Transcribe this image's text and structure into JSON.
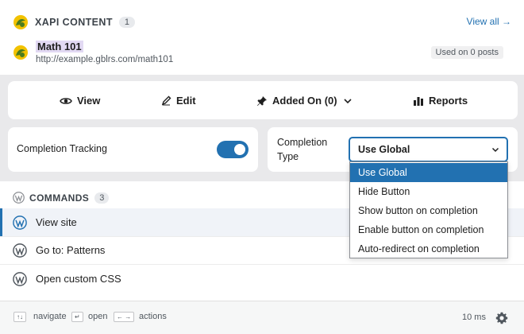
{
  "xapi": {
    "section_title": "XAPI CONTENT",
    "count": "1",
    "view_all": "View all →",
    "item": {
      "title": "Math 101",
      "url": "http://example.gblrs.com/math101",
      "usage": "Used on 0 posts"
    }
  },
  "actions": [
    {
      "label": "View",
      "icon": "eye-icon"
    },
    {
      "label": "Edit",
      "icon": "pencil-icon"
    },
    {
      "label": "Added On (0)",
      "icon": "pin-icon"
    },
    {
      "label": "Reports",
      "icon": "bar-chart-icon"
    }
  ],
  "completion_tracking": {
    "label": "Completion Tracking",
    "enabled": true
  },
  "completion_type": {
    "label_line1": "Completion",
    "label_line2": "Type",
    "selected": "Use Global",
    "options": [
      "Use Global",
      "Hide Button",
      "Show button on completion",
      "Enable button on completion",
      "Auto-redirect on completion"
    ]
  },
  "commands": {
    "title": "COMMANDS",
    "count": "3",
    "items": [
      "View site",
      "Go to: Patterns",
      "Open custom CSS"
    ]
  },
  "footer": {
    "navigate_key": "↑↓",
    "navigate": "navigate",
    "open_key": "↵",
    "open": "open",
    "actions_key": "← →",
    "actions": "actions",
    "timing": "10 ms"
  },
  "colors": {
    "accent": "#2271b1",
    "panel_bg": "#e9e9eb",
    "logo_green": "#4a7c1f",
    "logo_yellow": "#f2c200"
  }
}
